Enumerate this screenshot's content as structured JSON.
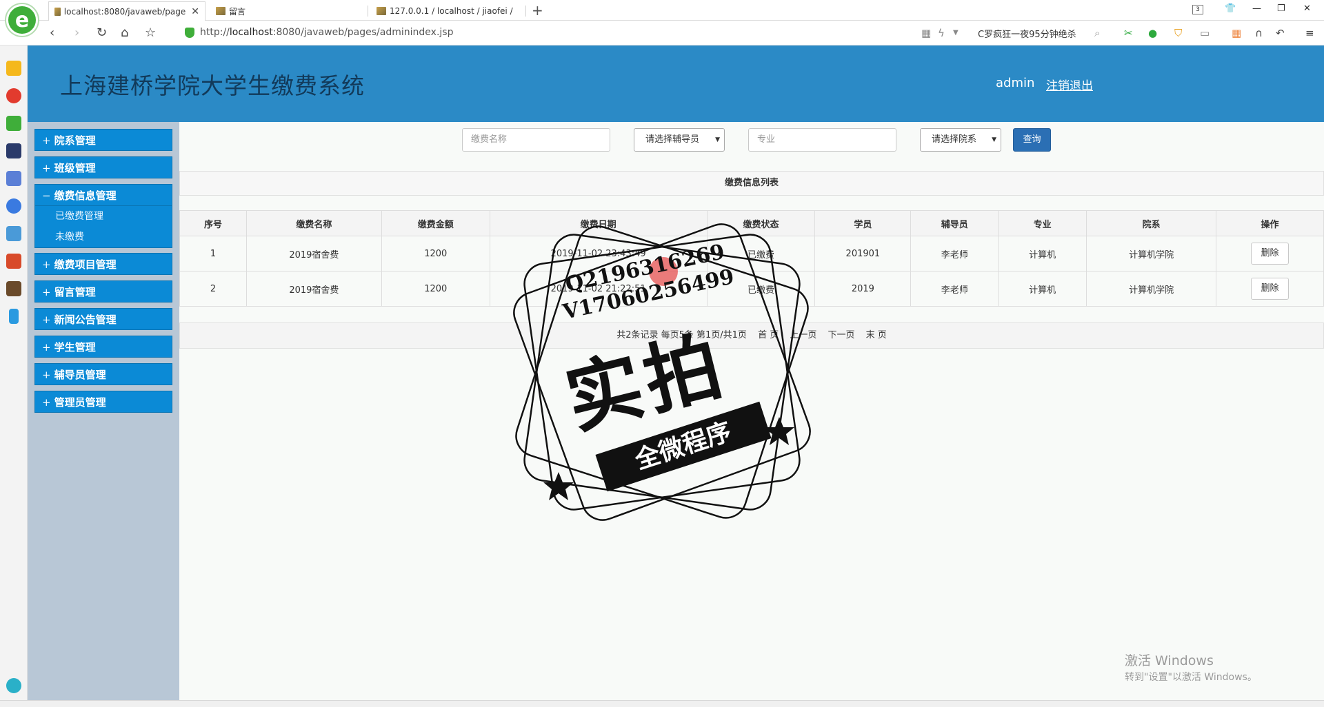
{
  "browser": {
    "tabs": [
      {
        "label": "localhost:8080/javaweb/page",
        "active": true
      },
      {
        "label": "留言",
        "active": false
      },
      {
        "label": "127.0.0.1 / localhost / jiaofei /",
        "active": false
      }
    ],
    "tab_count_badge": "3",
    "url_prefix": "http://",
    "url_host": "localhost",
    "url_rest": ":8080/javaweb/pages/adminindex.jsp",
    "search_text": "C罗疯狂一夜95分钟绝杀"
  },
  "header": {
    "title": "上海建桥学院大学生缴费系统",
    "user": "admin",
    "logout": "注销退出"
  },
  "menu": [
    {
      "sign": "+",
      "label": "院系管理"
    },
    {
      "sign": "+",
      "label": "班级管理"
    },
    {
      "sign": "−",
      "label": "缴费信息管理",
      "children": [
        "已缴费管理",
        "未缴费"
      ]
    },
    {
      "sign": "+",
      "label": "缴费项目管理"
    },
    {
      "sign": "+",
      "label": "留言管理"
    },
    {
      "sign": "+",
      "label": "新闻公告管理"
    },
    {
      "sign": "+",
      "label": "学生管理"
    },
    {
      "sign": "+",
      "label": "辅导员管理"
    },
    {
      "sign": "+",
      "label": "管理员管理"
    }
  ],
  "filters": {
    "name_placeholder": "缴费名称",
    "counselor_select": "请选择辅导员",
    "major_placeholder": "专业",
    "dept_select": "请选择院系",
    "query_button": "查询"
  },
  "list": {
    "title": "缴费信息列表",
    "columns": [
      "序号",
      "缴费名称",
      "缴费金额",
      "缴费日期",
      "缴费状态",
      "学员",
      "辅导员",
      "专业",
      "院系",
      "操作"
    ],
    "rows": [
      [
        "1",
        "2019宿舍费",
        "1200",
        "2019-11-02 23:43:49",
        "已缴费",
        "201901",
        "李老师",
        "计算机",
        "计算机学院",
        "删除"
      ],
      [
        "2",
        "2019宿舍费",
        "1200",
        "2019-11-02 21:22:51",
        "已缴费",
        "2019",
        "李老师",
        "计算机",
        "计算机学院",
        "删除"
      ]
    ]
  },
  "pager": {
    "summary": "共2条记录  每页5条  第1页/共1页",
    "first": "首 页",
    "prev": "上一页",
    "next": "下一页",
    "last": "末 页"
  },
  "watermark": {
    "line1": "Q2196316269",
    "line2": "V17060256499",
    "big": "实拍",
    "ribbon": "全微程序"
  },
  "os_notice": {
    "title": "激活 Windows",
    "subtitle": "转到\"设置\"以激活 Windows。"
  }
}
